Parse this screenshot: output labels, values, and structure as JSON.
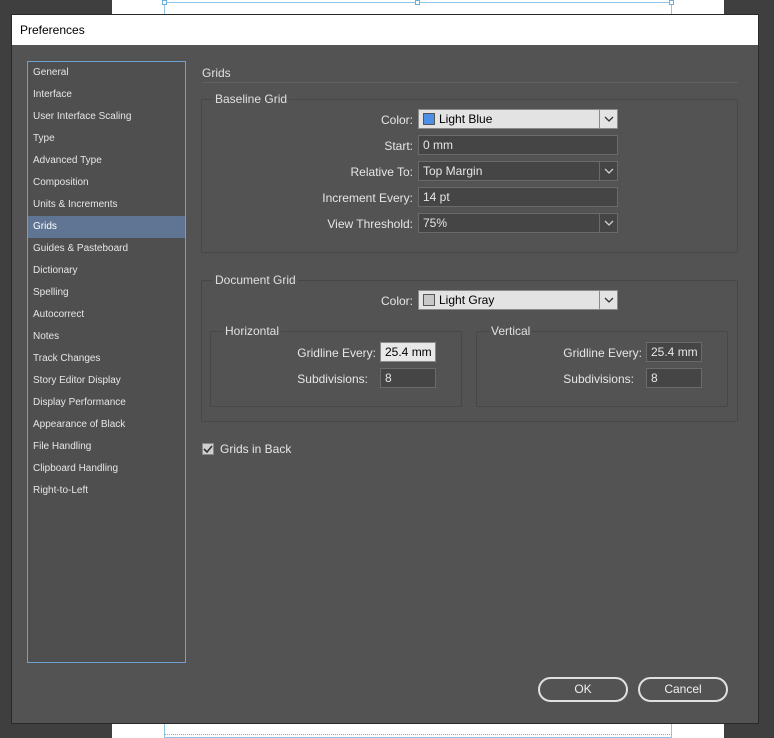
{
  "window": {
    "title": "Preferences"
  },
  "sidebar": {
    "items": [
      {
        "label": "General"
      },
      {
        "label": "Interface"
      },
      {
        "label": "User Interface Scaling"
      },
      {
        "label": "Type"
      },
      {
        "label": "Advanced Type"
      },
      {
        "label": "Composition"
      },
      {
        "label": "Units & Increments"
      },
      {
        "label": "Grids",
        "selected": true
      },
      {
        "label": "Guides & Pasteboard"
      },
      {
        "label": "Dictionary"
      },
      {
        "label": "Spelling"
      },
      {
        "label": "Autocorrect"
      },
      {
        "label": "Notes"
      },
      {
        "label": "Track Changes"
      },
      {
        "label": "Story Editor Display"
      },
      {
        "label": "Display Performance"
      },
      {
        "label": "Appearance of Black"
      },
      {
        "label": "File Handling"
      },
      {
        "label": "Clipboard Handling"
      },
      {
        "label": "Right-to-Left"
      }
    ]
  },
  "panel": {
    "title": "Grids",
    "baseline": {
      "legend": "Baseline Grid",
      "color_label": "Color:",
      "color_value": "Light Blue",
      "color_swatch": "#4d8fe6",
      "start_label": "Start:",
      "start_value": "0 mm",
      "relative_label": "Relative To:",
      "relative_value": "Top Margin",
      "increment_label": "Increment Every:",
      "increment_value": "14 pt",
      "threshold_label": "View Threshold:",
      "threshold_value": "75%"
    },
    "document": {
      "legend": "Document Grid",
      "color_label": "Color:",
      "color_value": "Light Gray",
      "color_swatch": "#c8c8c8",
      "horizontal": {
        "legend": "Horizontal",
        "gridline_label": "Gridline Every:",
        "gridline_value": "25.4 mm",
        "subdivisions_label": "Subdivisions:",
        "subdivisions_value": "8"
      },
      "vertical": {
        "legend": "Vertical",
        "gridline_label": "Gridline Every:",
        "gridline_value": "25.4 mm",
        "subdivisions_label": "Subdivisions:",
        "subdivisions_value": "8"
      }
    },
    "grids_in_back": {
      "label": "Grids in Back",
      "checked": true
    }
  },
  "buttons": {
    "ok": "OK",
    "cancel": "Cancel"
  },
  "icons": {
    "dropdown": "chevron-down-icon",
    "checkbox": "checkmark-icon"
  }
}
